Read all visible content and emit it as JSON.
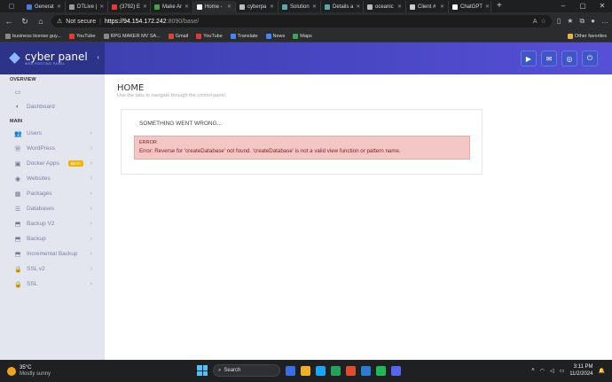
{
  "browser": {
    "tabs": [
      {
        "label": "Generat",
        "color": "#4a7bd9"
      },
      {
        "label": "DTLive |",
        "color": "#999999"
      },
      {
        "label": "(3792) E",
        "color": "#e53935"
      },
      {
        "label": "Make Ar",
        "color": "#43a047"
      },
      {
        "label": "Home -",
        "color": "#ffffff",
        "active": true
      },
      {
        "label": "cyberpa",
        "color": "#bbbbbb"
      },
      {
        "label": "Solution",
        "color": "#5aa9a9"
      },
      {
        "label": "Details a",
        "color": "#5aa9a9"
      },
      {
        "label": "oceanic",
        "color": "#bbbbbb"
      },
      {
        "label": "Client #",
        "color": "#cccccc"
      },
      {
        "label": "ChatGPT",
        "color": "#ffffff"
      }
    ],
    "security_label": "Not secure",
    "url_host": "https://94.154.172.242",
    "url_rest": ":8090/base/",
    "bookmarks": [
      {
        "label": "business license guy...",
        "color": "#888888"
      },
      {
        "label": "YouTube",
        "color": "#e53935"
      },
      {
        "label": "RPG MAKER MV SA...",
        "color": "#888888"
      },
      {
        "label": "Gmail",
        "color": "#d44638"
      },
      {
        "label": "YouTube",
        "color": "#e53935"
      },
      {
        "label": "Translate",
        "color": "#4285f4"
      },
      {
        "label": "News",
        "color": "#4285f4"
      },
      {
        "label": "Maps",
        "color": "#34a853"
      }
    ],
    "other_favorites": "Other favorites"
  },
  "app": {
    "brand_name": "cyber panel",
    "brand_sub": "WEB HOSTING PANEL",
    "sidebar": {
      "overview_heading": "OVERVIEW",
      "dashboard": "Dashboard",
      "main_heading": "MAIN",
      "items": [
        {
          "label": "Users",
          "icon": "users-icon",
          "glyph": "👥"
        },
        {
          "label": "WordPress",
          "icon": "wordpress-icon",
          "glyph": "Ⓦ"
        },
        {
          "label": "Docker Apps",
          "icon": "docker-icon",
          "glyph": "▣",
          "badge": "BETA"
        },
        {
          "label": "Websites",
          "icon": "globe-icon",
          "glyph": "◉"
        },
        {
          "label": "Packages",
          "icon": "package-icon",
          "glyph": "▦"
        },
        {
          "label": "Databases",
          "icon": "database-icon",
          "glyph": "☰"
        },
        {
          "label": "Backup V2",
          "icon": "backup-icon",
          "glyph": "⬒"
        },
        {
          "label": "Backup",
          "icon": "backup-icon",
          "glyph": "⬒"
        },
        {
          "label": "Incremental Backup",
          "icon": "backup-icon",
          "glyph": "⬒"
        },
        {
          "label": "SSL v2",
          "icon": "lock-icon",
          "glyph": "🔒"
        },
        {
          "label": "SSL",
          "icon": "lock-icon",
          "glyph": "🔒"
        }
      ]
    },
    "page_title": "HOME",
    "page_subtitle": "Use the tabs to navigate through the control panel.",
    "card_title": "SOMETHING WENT WRONG...",
    "error_heading": "ERROR",
    "error_message": "Error: Reverse for 'createDatabase' not found. 'createDatabase' is not a valid view function or pattern name.",
    "colors": {
      "topbar": "#4a47c5",
      "sidebar": "#e4e6ef",
      "alert_bg": "#f4c7c7",
      "alert_text": "#842020"
    }
  },
  "taskbar": {
    "temperature": "35°C",
    "weather": "Mostly sunny",
    "search_label": "Search",
    "time": "3:11 PM",
    "date": "11/2/2024",
    "notification_count": "1"
  }
}
